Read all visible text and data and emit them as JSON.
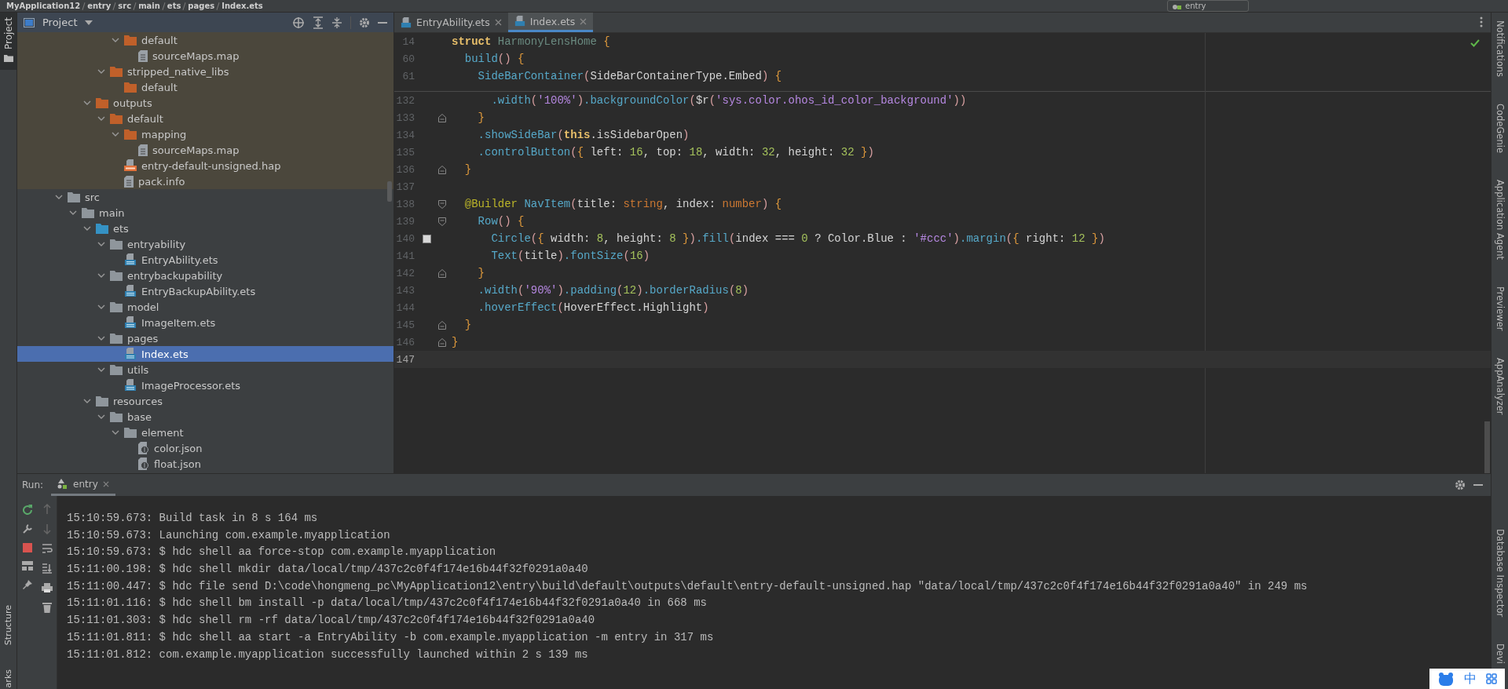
{
  "breadcrumb": [
    "MyApplication12",
    "entry",
    "src",
    "main",
    "ets",
    "pages",
    "Index.ets"
  ],
  "run_config": {
    "value": "entry"
  },
  "left_strip": {
    "top": [
      {
        "label": "Project",
        "selected": true
      }
    ],
    "bottom": [
      {
        "label": "Structure"
      },
      {
        "label": "arks"
      }
    ]
  },
  "project": {
    "title": "Project",
    "tree": [
      {
        "children": [
          {
            "children": [
              {
                "children": [
                  {
                    "children": [
                      {
                        "label": "default",
                        "kind": "folder",
                        "expanded": true,
                        "selected": false,
                        "generated": true,
                        "children": [
                          {
                            "label": "sourceMaps.map",
                            "kind": "doc",
                            "selected": false,
                            "generated": true
                          }
                        ]
                      }
                    ]
                  },
                  {
                    "label": "stripped_native_libs",
                    "kind": "folder",
                    "expanded": true,
                    "selected": false,
                    "generated": true,
                    "children": [
                      {
                        "label": "default",
                        "kind": "folder",
                        "expanded": false,
                        "selected": false,
                        "generated": true
                      }
                    ]
                  }
                ]
              },
              {
                "label": "outputs",
                "kind": "folder",
                "expanded": true,
                "selected": false,
                "generated": true,
                "children": [
                  {
                    "label": "default",
                    "kind": "folder",
                    "expanded": true,
                    "selected": false,
                    "generated": true,
                    "children": [
                      {
                        "label": "mapping",
                        "kind": "folder",
                        "expanded": true,
                        "selected": false,
                        "generated": true,
                        "children": [
                          {
                            "label": "sourceMaps.map",
                            "kind": "doc",
                            "selected": false,
                            "generated": true
                          }
                        ]
                      },
                      {
                        "label": "entry-default-unsigned.hap",
                        "kind": "hap",
                        "selected": false,
                        "generated": true
                      },
                      {
                        "label": "pack.info",
                        "kind": "doc",
                        "selected": false,
                        "generated": true
                      }
                    ]
                  }
                ]
              }
            ]
          }
        ]
      },
      {
        "label": "src",
        "kind": "folder",
        "expanded": true,
        "selected": false,
        "generated": false,
        "children": [
          {
            "label": "main",
            "kind": "folder",
            "expanded": true,
            "selected": false,
            "generated": false,
            "children": [
              {
                "label": "ets",
                "kind": "source-folder",
                "expanded": true,
                "selected": false,
                "generated": false,
                "children": [
                  {
                    "label": "entryability",
                    "kind": "folder",
                    "expanded": true,
                    "selected": false,
                    "generated": false,
                    "children": [
                      {
                        "label": "EntryAbility.ets",
                        "kind": "ets",
                        "selected": false,
                        "generated": false
                      }
                    ]
                  },
                  {
                    "label": "entrybackupability",
                    "kind": "folder",
                    "expanded": true,
                    "selected": false,
                    "generated": false,
                    "children": [
                      {
                        "label": "EntryBackupAbility.ets",
                        "kind": "ets",
                        "selected": false,
                        "generated": false
                      }
                    ]
                  },
                  {
                    "label": "model",
                    "kind": "folder",
                    "expanded": true,
                    "selected": false,
                    "generated": false,
                    "children": [
                      {
                        "label": "ImageItem.ets",
                        "kind": "ets",
                        "selected": false,
                        "generated": false
                      }
                    ]
                  },
                  {
                    "label": "pages",
                    "kind": "folder",
                    "expanded": true,
                    "selected": false,
                    "generated": false,
                    "children": [
                      {
                        "label": "Index.ets",
                        "kind": "ets",
                        "selected": true,
                        "generated": false
                      }
                    ]
                  },
                  {
                    "label": "utils",
                    "kind": "folder",
                    "expanded": true,
                    "selected": false,
                    "generated": false,
                    "children": [
                      {
                        "label": "ImageProcessor.ets",
                        "kind": "ets",
                        "selected": false,
                        "generated": false
                      }
                    ]
                  }
                ]
              },
              {
                "label": "resources",
                "kind": "folder",
                "expanded": true,
                "selected": false,
                "generated": false,
                "children": [
                  {
                    "label": "base",
                    "kind": "folder",
                    "expanded": true,
                    "selected": false,
                    "generated": false,
                    "children": [
                      {
                        "label": "element",
                        "kind": "folder",
                        "expanded": true,
                        "selected": false,
                        "generated": false,
                        "children": [
                          {
                            "label": "color.json",
                            "kind": "json",
                            "selected": false,
                            "generated": false
                          },
                          {
                            "label": "float.json",
                            "kind": "json",
                            "selected": false,
                            "generated": false
                          }
                        ]
                      }
                    ]
                  }
                ]
              }
            ]
          }
        ]
      }
    ]
  },
  "editor": {
    "tabs": [
      {
        "label": "EntryAbility.ets",
        "selected": false
      },
      {
        "label": "Index.ets",
        "selected": true
      }
    ],
    "sticky_lines": [
      {
        "n": "14",
        "tokens": [
          {
            "kind": "keyword",
            "text": "struct "
          },
          {
            "kind": "name",
            "text": "HarmonyLensHome "
          },
          {
            "kind": "brace",
            "text": "{"
          }
        ]
      },
      {
        "n": "60",
        "tokens": [
          {
            "kind": "func",
            "text": "  build"
          },
          {
            "kind": "paren",
            "text": "()"
          },
          {
            "kind": "brace",
            "text": " {"
          }
        ]
      },
      {
        "n": "61",
        "tokens": [
          {
            "kind": "func",
            "text": "    SideBarContainer"
          },
          {
            "kind": "paren",
            "text": "("
          },
          {
            "kind": "plain",
            "text": "SideBarContainerType.Embed"
          },
          {
            "kind": "paren",
            "text": ")"
          },
          {
            "kind": "brace",
            "text": " {"
          }
        ]
      }
    ],
    "lines": [
      {
        "n": "132",
        "current": false,
        "bookmark": false,
        "tokens": [
          {
            "kind": "func",
            "text": "      .width"
          },
          {
            "kind": "paren",
            "text": "("
          },
          {
            "kind": "string",
            "text": "'100%'"
          },
          {
            "kind": "paren",
            "text": ")"
          },
          {
            "kind": "func",
            "text": ".backgroundColor"
          },
          {
            "kind": "paren",
            "text": "("
          },
          {
            "kind": "plain",
            "text": "$r"
          },
          {
            "kind": "paren",
            "text": "("
          },
          {
            "kind": "string",
            "text": "'sys.color.ohos_id_color_background'"
          },
          {
            "kind": "paren",
            "text": "))"
          }
        ]
      },
      {
        "n": "133",
        "current": false,
        "bookmark": false,
        "fold": {
          "kind": "end"
        },
        "tokens": [
          {
            "kind": "brace",
            "text": "    }"
          }
        ]
      },
      {
        "n": "134",
        "current": false,
        "bookmark": false,
        "tokens": [
          {
            "kind": "func",
            "text": "    .showSideBar"
          },
          {
            "kind": "paren",
            "text": "("
          },
          {
            "kind": "keyword",
            "text": "this"
          },
          {
            "kind": "plain",
            "text": ".isSidebarOpen"
          },
          {
            "kind": "paren",
            "text": ")"
          }
        ]
      },
      {
        "n": "135",
        "current": false,
        "bookmark": false,
        "tokens": [
          {
            "kind": "func",
            "text": "    .controlButton"
          },
          {
            "kind": "paren",
            "text": "("
          },
          {
            "kind": "brace",
            "text": "{"
          },
          {
            "kind": "plain",
            "text": " left: "
          },
          {
            "kind": "number",
            "text": "16"
          },
          {
            "kind": "plain",
            "text": ", top: "
          },
          {
            "kind": "number",
            "text": "18"
          },
          {
            "kind": "plain",
            "text": ", width: "
          },
          {
            "kind": "number",
            "text": "32"
          },
          {
            "kind": "plain",
            "text": ", height: "
          },
          {
            "kind": "number",
            "text": "32"
          },
          {
            "kind": "brace",
            "text": " }"
          },
          {
            "kind": "paren",
            "text": ")"
          }
        ]
      },
      {
        "n": "136",
        "current": false,
        "bookmark": false,
        "fold": {
          "kind": "end"
        },
        "tokens": [
          {
            "kind": "brace",
            "text": "  }"
          }
        ]
      },
      {
        "n": "137",
        "current": false,
        "bookmark": false
      },
      {
        "n": "138",
        "current": false,
        "bookmark": false,
        "fold": {
          "kind": "start"
        },
        "tokens": [
          {
            "kind": "annotation",
            "text": "  @Builder "
          },
          {
            "kind": "func",
            "text": "NavItem"
          },
          {
            "kind": "paren",
            "text": "("
          },
          {
            "kind": "plain",
            "text": "title: "
          },
          {
            "kind": "type",
            "text": "string"
          },
          {
            "kind": "plain",
            "text": ", index: "
          },
          {
            "kind": "type",
            "text": "number"
          },
          {
            "kind": "paren",
            "text": ")"
          },
          {
            "kind": "brace",
            "text": " {"
          }
        ]
      },
      {
        "n": "139",
        "current": false,
        "bookmark": false,
        "fold": {
          "kind": "start"
        },
        "tokens": [
          {
            "kind": "func",
            "text": "    Row"
          },
          {
            "kind": "paren",
            "text": "()"
          },
          {
            "kind": "brace",
            "text": " {"
          }
        ]
      },
      {
        "n": "140",
        "current": false,
        "bookmark": true,
        "tokens": [
          {
            "kind": "func",
            "text": "      Circle"
          },
          {
            "kind": "paren",
            "text": "("
          },
          {
            "kind": "brace",
            "text": "{"
          },
          {
            "kind": "plain",
            "text": " width: "
          },
          {
            "kind": "number",
            "text": "8"
          },
          {
            "kind": "plain",
            "text": ", height: "
          },
          {
            "kind": "number",
            "text": "8"
          },
          {
            "kind": "brace",
            "text": " }"
          },
          {
            "kind": "paren",
            "text": ")"
          },
          {
            "kind": "func",
            "text": ".fill"
          },
          {
            "kind": "paren",
            "text": "("
          },
          {
            "kind": "plain",
            "text": "index === "
          },
          {
            "kind": "number",
            "text": "0"
          },
          {
            "kind": "plain",
            "text": " ? Color.Blue : "
          },
          {
            "kind": "string",
            "text": "'#ccc'"
          },
          {
            "kind": "paren",
            "text": ")"
          },
          {
            "kind": "func",
            "text": ".margin"
          },
          {
            "kind": "paren",
            "text": "("
          },
          {
            "kind": "brace",
            "text": "{"
          },
          {
            "kind": "plain",
            "text": " right: "
          },
          {
            "kind": "number",
            "text": "12"
          },
          {
            "kind": "brace",
            "text": " }"
          },
          {
            "kind": "paren",
            "text": ")"
          }
        ]
      },
      {
        "n": "141",
        "current": false,
        "bookmark": false,
        "tokens": [
          {
            "kind": "func",
            "text": "      Text"
          },
          {
            "kind": "paren",
            "text": "("
          },
          {
            "kind": "plain",
            "text": "title"
          },
          {
            "kind": "paren",
            "text": ")"
          },
          {
            "kind": "func",
            "text": ".fontSize"
          },
          {
            "kind": "paren",
            "text": "("
          },
          {
            "kind": "number",
            "text": "16"
          },
          {
            "kind": "paren",
            "text": ")"
          }
        ]
      },
      {
        "n": "142",
        "current": false,
        "bookmark": false,
        "fold": {
          "kind": "end"
        },
        "tokens": [
          {
            "kind": "brace",
            "text": "    }"
          }
        ]
      },
      {
        "n": "143",
        "current": false,
        "bookmark": false,
        "tokens": [
          {
            "kind": "func",
            "text": "    .width"
          },
          {
            "kind": "paren",
            "text": "("
          },
          {
            "kind": "string",
            "text": "'90%'"
          },
          {
            "kind": "paren",
            "text": ")"
          },
          {
            "kind": "func",
            "text": ".padding"
          },
          {
            "kind": "paren",
            "text": "("
          },
          {
            "kind": "number",
            "text": "12"
          },
          {
            "kind": "paren",
            "text": ")"
          },
          {
            "kind": "func",
            "text": ".borderRadius"
          },
          {
            "kind": "paren",
            "text": "("
          },
          {
            "kind": "number",
            "text": "8"
          },
          {
            "kind": "paren",
            "text": ")"
          }
        ]
      },
      {
        "n": "144",
        "current": false,
        "bookmark": false,
        "tokens": [
          {
            "kind": "func",
            "text": "    .hoverEffect"
          },
          {
            "kind": "paren",
            "text": "("
          },
          {
            "kind": "plain",
            "text": "HoverEffect.Highlight"
          },
          {
            "kind": "paren",
            "text": ")"
          }
        ]
      },
      {
        "n": "145",
        "current": false,
        "bookmark": false,
        "fold": {
          "kind": "end"
        },
        "tokens": [
          {
            "kind": "brace",
            "text": "  }"
          }
        ]
      },
      {
        "n": "146",
        "current": false,
        "bookmark": false,
        "fold": {
          "kind": "end"
        },
        "tokens": [
          {
            "kind": "brace",
            "text": "}"
          }
        ]
      },
      {
        "n": "147",
        "current": true,
        "bookmark": false
      }
    ]
  },
  "right_strip": [
    "Notifications",
    "CodeGenie",
    "Application Agent",
    "Previewer",
    "AppAnalyzer",
    "Database Inspector",
    "Devi"
  ],
  "run": {
    "label": "Run:",
    "tabs": [
      {
        "label": "entry",
        "selected": true
      }
    ],
    "console": [
      "15:10:59.673: Build task in 8 s 164 ms",
      "15:10:59.673: Launching com.example.myapplication",
      "15:10:59.673: $ hdc shell aa force-stop com.example.myapplication",
      "15:11:00.198: $ hdc shell mkdir data/local/tmp/437c2c0f4f174e16b44f32f0291a0a40",
      "15:11:00.447: $ hdc file send D:\\code\\hongmeng_pc\\MyApplication12\\entry\\build\\default\\outputs\\default\\entry-default-unsigned.hap \"data/local/tmp/437c2c0f4f174e16b44f32f0291a0a40\" in 249 ms",
      "15:11:01.116: $ hdc shell bm install -p data/local/tmp/437c2c0f4f174e16b44f32f0291a0a40 in 668 ms",
      "15:11:01.303: $ hdc shell rm -rf data/local/tmp/437c2c0f4f174e16b44f32f0291a0a40",
      "15:11:01.811: $ hdc shell aa start -a EntryAbility -b com.example.myapplication -m entry in 317 ms",
      "15:11:01.812: com.example.myapplication successfully launched within 2 s 139 ms"
    ]
  },
  "ime": {
    "mode": "中"
  }
}
